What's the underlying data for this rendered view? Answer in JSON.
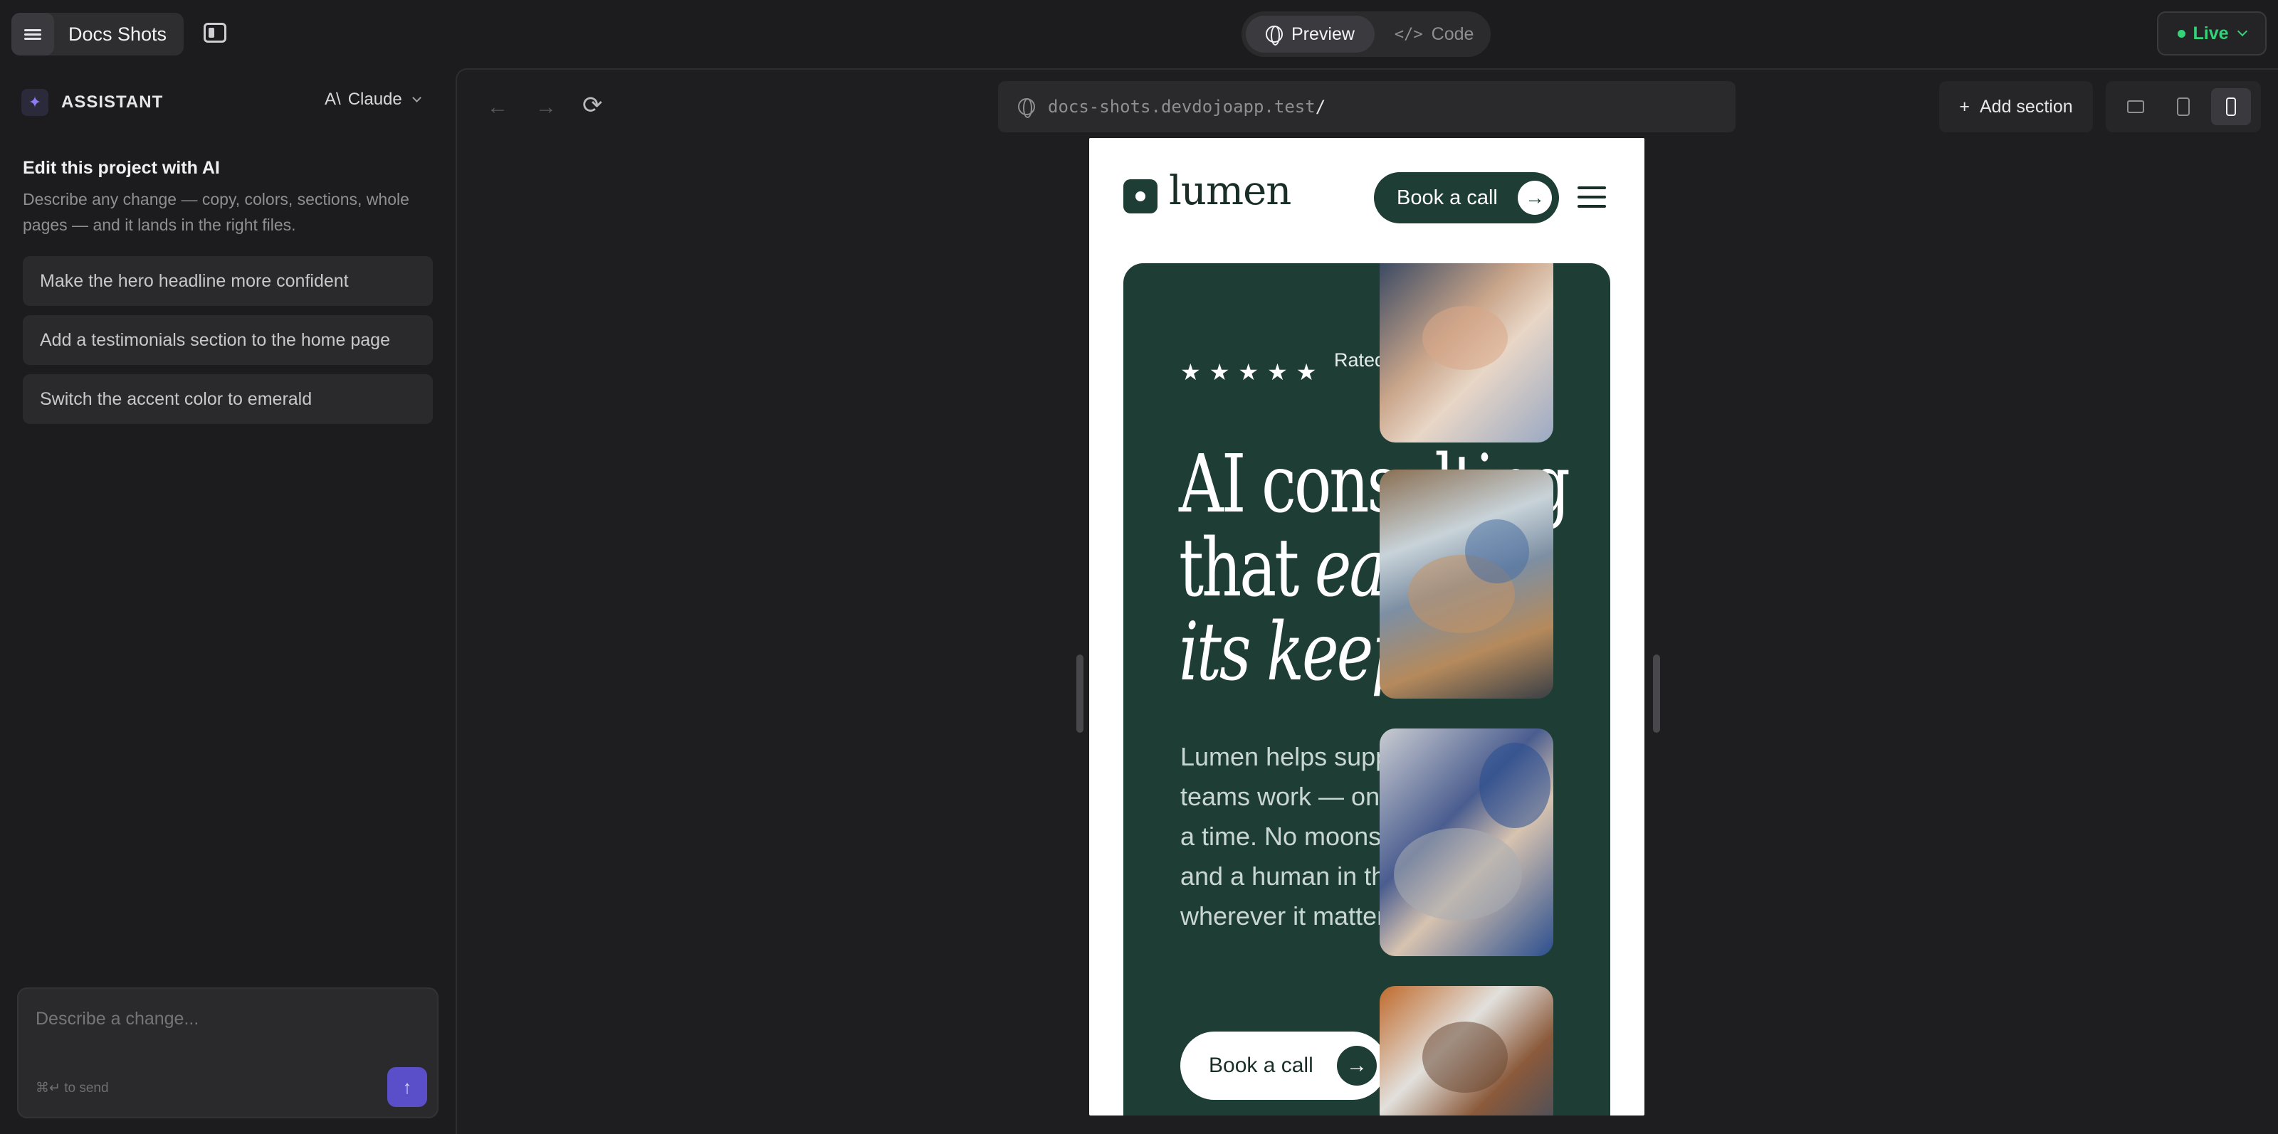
{
  "app": {
    "project_name": "Docs Shots",
    "mode_tabs": [
      {
        "label": "Preview",
        "icon": "globe-icon",
        "active": true
      },
      {
        "label": "Code",
        "icon": "code-icon",
        "active": false
      }
    ],
    "status": {
      "label": "Live",
      "color": "#34d27a"
    }
  },
  "assistant": {
    "title": "ASSISTANT",
    "model": "Claude",
    "intro_title": "Edit this project with AI",
    "intro_desc": "Describe any change — copy, colors, sections, whole pages — and it lands in the right files.",
    "suggestions": [
      "Make the hero headline more confident",
      "Add a testimonials section to the home page",
      "Switch the accent color to emerald"
    ],
    "composer_placeholder": "Describe a change...",
    "composer_hint": "⌘↵ to send",
    "accent": "#5b4fc9"
  },
  "browser": {
    "url_host": "docs-shots.devdojoapp.test",
    "url_path": "/",
    "add_section_label": "Add section",
    "devices": [
      "desktop",
      "tablet",
      "phone"
    ],
    "active_device": "phone"
  },
  "site": {
    "logo": "lumen",
    "header_cta": "Book a call",
    "rated_text": "Rated team",
    "headline_l1": "AI consulting",
    "headline_l2a": "that ",
    "headline_l2b": "earns",
    "headline_l3": "its keep",
    "lede": "Lumen helps support operations teams work — one measurable a time. No moonshot jargon, and a human in the loop wherever it matters.",
    "cta": "Book a call",
    "brand_color": "#1e3d35",
    "star_count": 5
  }
}
